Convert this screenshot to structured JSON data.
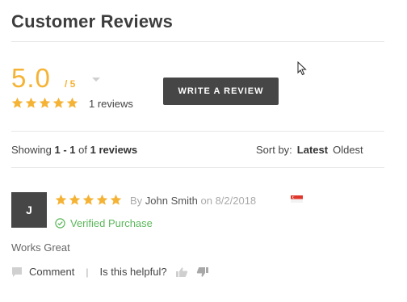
{
  "header": {
    "title": "Customer Reviews"
  },
  "summary": {
    "score": "5.0",
    "score_max": "/ 5",
    "rating_stars": 5,
    "review_count": "1 reviews",
    "write_button": "WRITE A REVIEW"
  },
  "listing": {
    "showing_prefix": "Showing",
    "range": "1 - 1",
    "of": "of",
    "total": "1 reviews",
    "sort_label": "Sort by:",
    "sort_options": [
      "Latest",
      "Oldest"
    ],
    "active_sort": "Latest"
  },
  "review": {
    "avatar_initial": "J",
    "rating_stars": 5,
    "by": "By",
    "author": "John Smith",
    "on": "on",
    "date": "8/2/2018",
    "verified": "Verified Purchase",
    "body": "Works Great",
    "comment_label": "Comment",
    "separator": "|",
    "helpful_label": "Is this helpful?"
  },
  "colors": {
    "accent_star": "#f5b336",
    "button_dark": "#464646",
    "verified_green": "#5cb85c"
  },
  "icons": [
    "star-icon",
    "chevron-down-icon",
    "cursor-icon",
    "flag-icon",
    "check-circle-icon",
    "comment-icon",
    "thumbs-up-icon",
    "thumbs-down-icon"
  ]
}
